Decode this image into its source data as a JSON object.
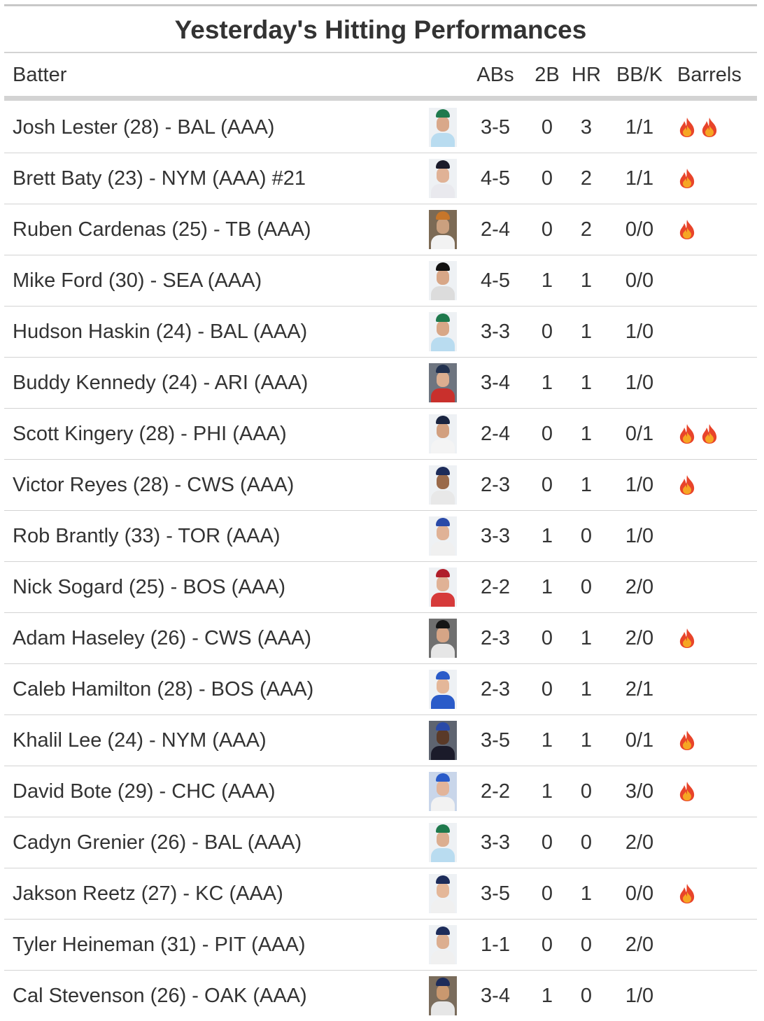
{
  "title": "Yesterday's Hitting Performances",
  "columns": {
    "batter": "Batter",
    "abs": "ABs",
    "doubles": "2B",
    "hr": "HR",
    "bbk": "BB/K",
    "barrels": "Barrels"
  },
  "colors": {
    "text": "#333333",
    "rule": "#d3d3d3"
  },
  "rows": [
    {
      "batter": "Josh Lester (28) - BAL (AAA)",
      "abs": "3-5",
      "doubles": "0",
      "hr": "3",
      "bbk": "1/1",
      "barrels": 2,
      "cap": "#1f7a4d",
      "jersey": "#b9dcf0",
      "skin": "#d9a88a",
      "bg": "#eef1f4"
    },
    {
      "batter": "Brett Baty (23) - NYM (AAA) #21",
      "abs": "4-5",
      "doubles": "0",
      "hr": "2",
      "bbk": "1/1",
      "barrels": 1,
      "cap": "#1b1b2a",
      "jersey": "#e9e9ee",
      "skin": "#e0b296",
      "bg": "#eef1f4"
    },
    {
      "batter": "Ruben Cardenas (25) - TB (AAA)",
      "abs": "2-4",
      "doubles": "0",
      "hr": "2",
      "bbk": "0/0",
      "barrels": 1,
      "cap": "#c7762a",
      "jersey": "#f2f2f2",
      "skin": "#caa07f",
      "bg": "#7c6a55"
    },
    {
      "batter": "Mike Ford (30) - SEA (AAA)",
      "abs": "4-5",
      "doubles": "1",
      "hr": "1",
      "bbk": "0/0",
      "barrels": 0,
      "cap": "#111111",
      "jersey": "#dcdcdc",
      "skin": "#d8a787",
      "bg": "#eef1f4"
    },
    {
      "batter": "Hudson Haskin (24) - BAL (AAA)",
      "abs": "3-3",
      "doubles": "0",
      "hr": "1",
      "bbk": "1/0",
      "barrels": 0,
      "cap": "#1f7a4d",
      "jersey": "#b9dcf0",
      "skin": "#d8a787",
      "bg": "#eef1f4"
    },
    {
      "batter": "Buddy Kennedy (24) - ARI (AAA)",
      "abs": "3-4",
      "doubles": "1",
      "hr": "1",
      "bbk": "1/0",
      "barrels": 0,
      "cap": "#22314f",
      "jersey": "#c9302c",
      "skin": "#dcae90",
      "bg": "#6e7580"
    },
    {
      "batter": "Scott Kingery (28) - PHI (AAA)",
      "abs": "2-4",
      "doubles": "0",
      "hr": "1",
      "bbk": "0/1",
      "barrels": 2,
      "cap": "#1a2440",
      "jersey": "#f4f4f4",
      "skin": "#d2a080",
      "bg": "#eef1f4"
    },
    {
      "batter": "Victor Reyes (28) - CWS (AAA)",
      "abs": "2-3",
      "doubles": "0",
      "hr": "1",
      "bbk": "1/0",
      "barrels": 1,
      "cap": "#1d2c5a",
      "jersey": "#e8e8e8",
      "skin": "#9a6a4a",
      "bg": "#eef1f4"
    },
    {
      "batter": "Rob Brantly (33) - TOR (AAA)",
      "abs": "3-3",
      "doubles": "1",
      "hr": "0",
      "bbk": "1/0",
      "barrels": 0,
      "cap": "#2a4aa8",
      "jersey": "#f0f0f0",
      "skin": "#e0b296",
      "bg": "#eef1f4"
    },
    {
      "batter": "Nick Sogard (25) - BOS (AAA)",
      "abs": "2-2",
      "doubles": "1",
      "hr": "0",
      "bbk": "2/0",
      "barrels": 0,
      "cap": "#b01e2a",
      "jersey": "#d63a3a",
      "skin": "#e0b296",
      "bg": "#eef1f4"
    },
    {
      "batter": "Adam Haseley (26) - CWS (AAA)",
      "abs": "2-3",
      "doubles": "0",
      "hr": "1",
      "bbk": "2/0",
      "barrels": 1,
      "cap": "#151515",
      "jersey": "#e6e6e6",
      "skin": "#d6a586",
      "bg": "#6f6f6f"
    },
    {
      "batter": "Caleb Hamilton (28) - BOS (AAA)",
      "abs": "2-3",
      "doubles": "0",
      "hr": "1",
      "bbk": "2/1",
      "barrels": 0,
      "cap": "#2a5bc9",
      "jersey": "#2a5bc9",
      "skin": "#e4b799",
      "bg": "#eef1f4"
    },
    {
      "batter": "Khalil Lee (24) - NYM (AAA)",
      "abs": "3-5",
      "doubles": "1",
      "hr": "1",
      "bbk": "0/1",
      "barrels": 1,
      "cap": "#2a4aa8",
      "jersey": "#1b1b2a",
      "skin": "#5a3a28",
      "bg": "#5e6470"
    },
    {
      "batter": "David Bote (29) - CHC (AAA)",
      "abs": "2-2",
      "doubles": "1",
      "hr": "0",
      "bbk": "3/0",
      "barrels": 1,
      "cap": "#2a5bc9",
      "jersey": "#f2f2f2",
      "skin": "#e2b49a",
      "bg": "#c9d6ea"
    },
    {
      "batter": "Cadyn Grenier (26) - BAL (AAA)",
      "abs": "3-3",
      "doubles": "0",
      "hr": "0",
      "bbk": "2/0",
      "barrels": 0,
      "cap": "#1f7a4d",
      "jersey": "#b9dcf0",
      "skin": "#dcae90",
      "bg": "#eef1f4"
    },
    {
      "batter": "Jakson Reetz (27) - KC (AAA)",
      "abs": "3-5",
      "doubles": "0",
      "hr": "1",
      "bbk": "0/0",
      "barrels": 1,
      "cap": "#1d2c5a",
      "jersey": "#f0f0f0",
      "skin": "#e4b799",
      "bg": "#eef1f4"
    },
    {
      "batter": "Tyler Heineman (31) - PIT (AAA)",
      "abs": "1-1",
      "doubles": "0",
      "hr": "0",
      "bbk": "2/0",
      "barrels": 0,
      "cap": "#1d2c5a",
      "jersey": "#f0f0f0",
      "skin": "#dcae90",
      "bg": "#eef1f4"
    },
    {
      "batter": "Cal Stevenson (26) - OAK (AAA)",
      "abs": "3-4",
      "doubles": "1",
      "hr": "0",
      "bbk": "1/0",
      "barrels": 0,
      "cap": "#1d2c5a",
      "jersey": "#e6e6e6",
      "skin": "#c9986f",
      "bg": "#7a6c5c"
    }
  ]
}
